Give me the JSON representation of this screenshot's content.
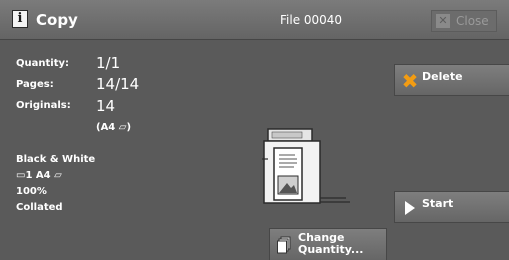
{
  "titlebar": {
    "icon": "info-icon",
    "icon_glyph": "i",
    "title": "Copy",
    "file_name": "File 00040",
    "close_label": "Close",
    "close_icon_glyph": "✕"
  },
  "info": {
    "quantity_label": "Quantity:",
    "quantity_value": "1/1",
    "pages_label": "Pages:",
    "pages_value": "14/14",
    "originals_label": "Originals:",
    "originals_value": "14",
    "originals_size": "(A4 ▱)"
  },
  "settings": {
    "color_mode": "Black & White",
    "tray": "▭1  A4 ▱",
    "zoom": "100%",
    "collation": "Collated"
  },
  "actions": {
    "delete_label": "Delete",
    "delete_glyph": "✖",
    "start_label": "Start",
    "change_quantity_line1": "Change",
    "change_quantity_line2": "Quantity..."
  },
  "colors": {
    "background": "#5a5a5a",
    "delete_accent": "#f39c12",
    "disabled_text": "#9a9a9a"
  }
}
